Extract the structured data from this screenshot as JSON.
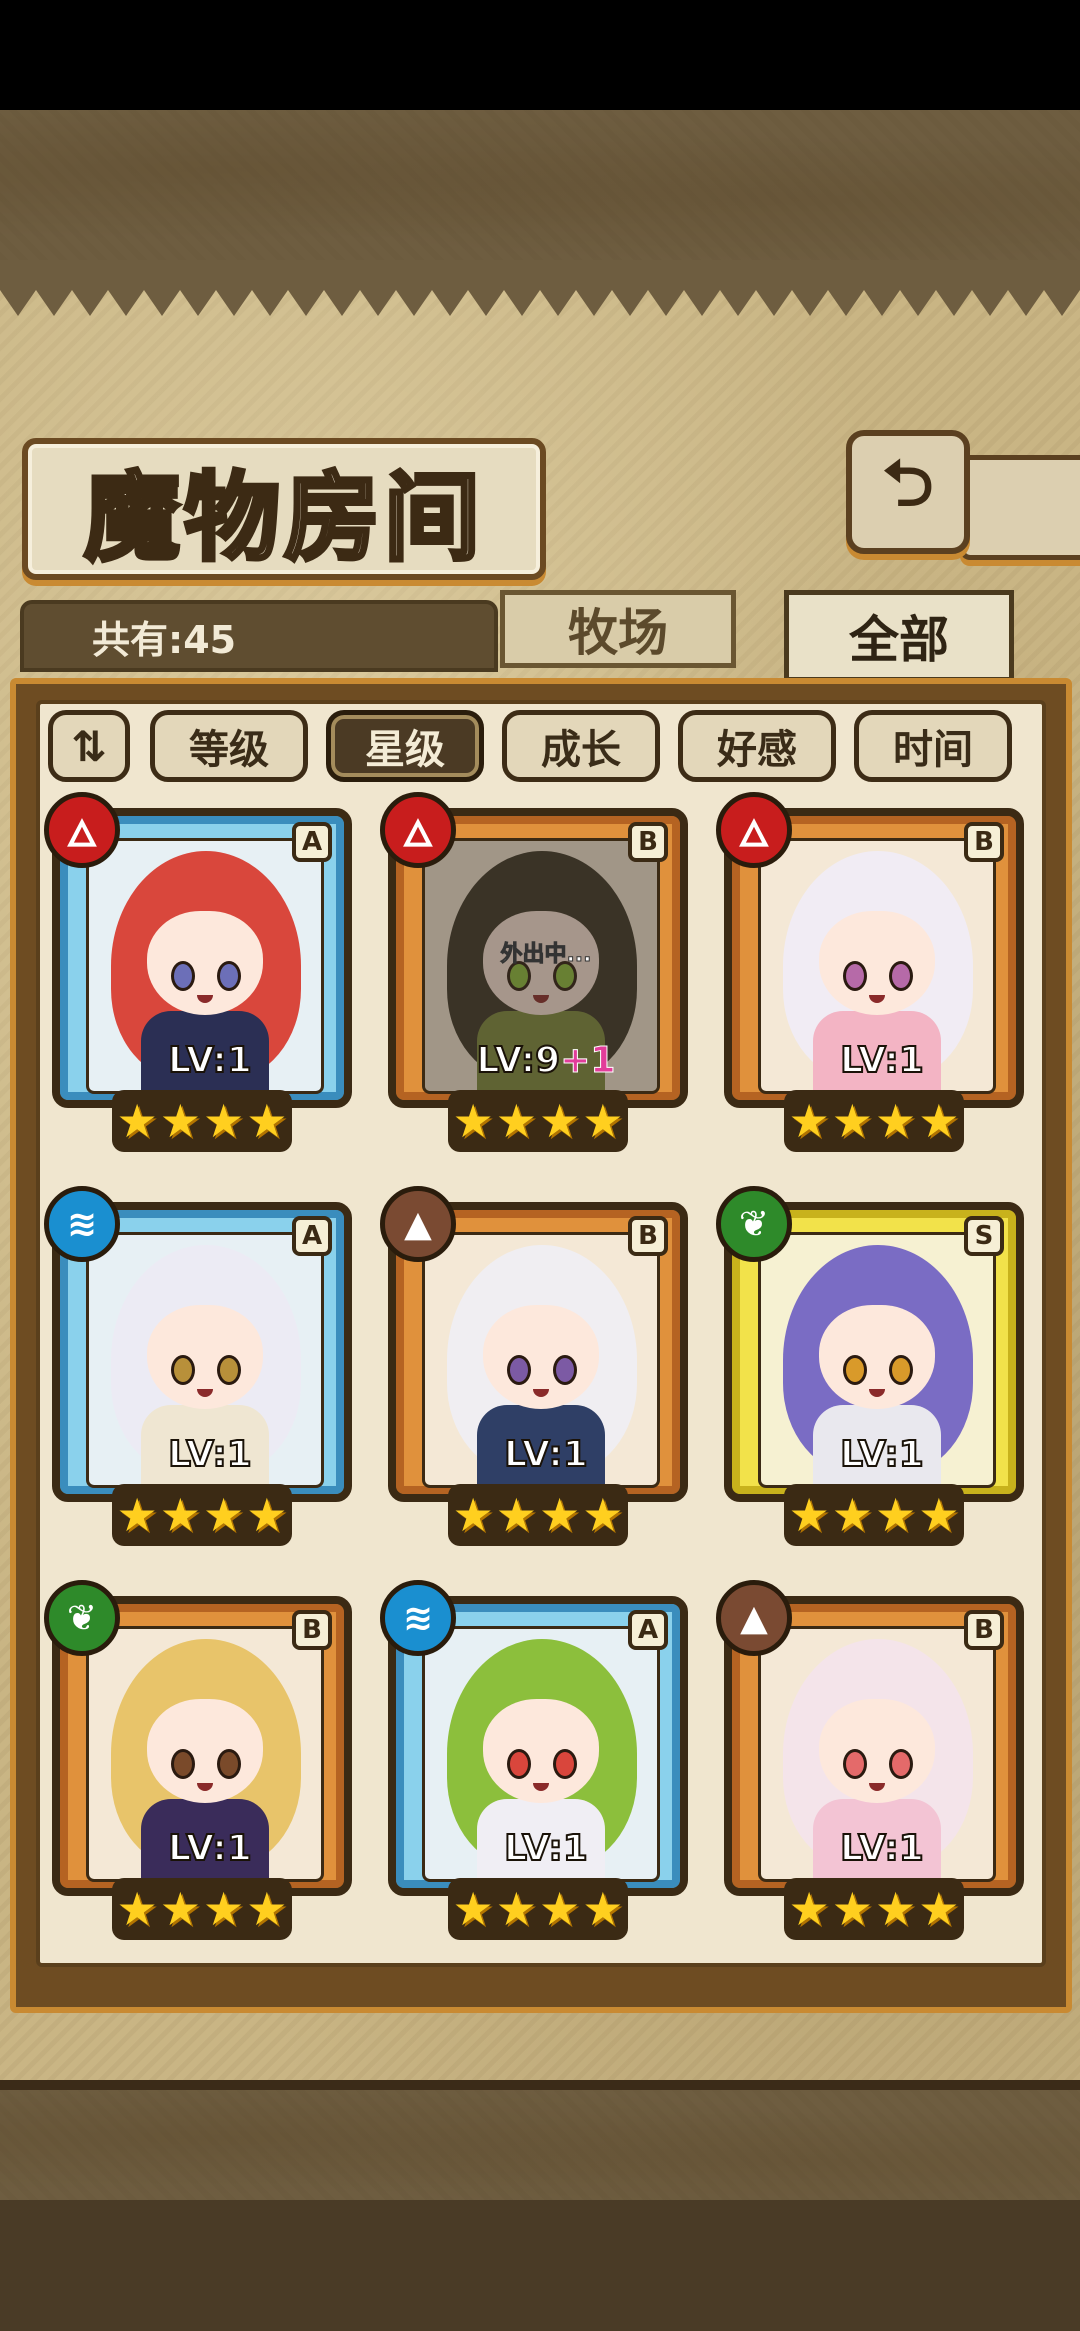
{
  "title": "魔物房间",
  "back_icon": "back-return-icon",
  "count_label": "共有:45",
  "tabs": [
    {
      "label": "牧场",
      "active": false
    },
    {
      "label": "全部",
      "active": true
    }
  ],
  "sort": {
    "toggle_icon": "sort-direction-icon",
    "buttons": [
      {
        "label": "等级",
        "active": false
      },
      {
        "label": "星级",
        "active": true
      },
      {
        "label": "成长",
        "active": false
      },
      {
        "label": "好感",
        "active": false
      },
      {
        "label": "时间",
        "active": false
      }
    ]
  },
  "monsters": [
    {
      "rank": "A",
      "element": "fire",
      "frame": "blue",
      "level": "LV:1",
      "bonus": "",
      "stars": 4,
      "away": "",
      "colors": {
        "hair": "#d9473c",
        "body": "#2b2f54",
        "eye": "#6c6fb8"
      }
    },
    {
      "rank": "B",
      "element": "fire",
      "frame": "orange",
      "level": "LV:9",
      "bonus": "+1",
      "stars": 4,
      "away": "外出中...",
      "colors": {
        "hair": "#3a3326",
        "body": "#7c8a3c",
        "eye": "#8cc03c"
      }
    },
    {
      "rank": "B",
      "element": "fire",
      "frame": "orange",
      "level": "LV:1",
      "bonus": "",
      "stars": 4,
      "away": "",
      "colors": {
        "hair": "#f1ecf4",
        "body": "#f3b4c4",
        "eye": "#b66aa8"
      }
    },
    {
      "rank": "A",
      "element": "water",
      "frame": "blue",
      "level": "LV:1",
      "bonus": "",
      "stars": 4,
      "away": "",
      "colors": {
        "hair": "#ecebf4",
        "body": "#efe6d2",
        "eye": "#b8903a"
      }
    },
    {
      "rank": "B",
      "element": "earth",
      "frame": "orange",
      "level": "LV:1",
      "bonus": "",
      "stars": 4,
      "away": "",
      "colors": {
        "hair": "#f0eef2",
        "body": "#2f3f66",
        "eye": "#7c5aa4"
      }
    },
    {
      "rank": "S",
      "element": "wind",
      "frame": "yellow",
      "level": "LV:1",
      "bonus": "",
      "stars": 4,
      "away": "",
      "colors": {
        "hair": "#7a6cc4",
        "body": "#e9e8ee",
        "eye": "#d99a2a"
      }
    },
    {
      "rank": "B",
      "element": "wind",
      "frame": "orange",
      "level": "LV:1",
      "bonus": "",
      "stars": 4,
      "away": "",
      "colors": {
        "hair": "#e8c46a",
        "body": "#3a2c5a",
        "eye": "#7a4a2a"
      }
    },
    {
      "rank": "A",
      "element": "water",
      "frame": "blue",
      "level": "LV:1",
      "bonus": "",
      "stars": 4,
      "away": "",
      "colors": {
        "hair": "#8cbf3c",
        "body": "#f0eef4",
        "eye": "#d9463c"
      }
    },
    {
      "rank": "B",
      "element": "earth",
      "frame": "orange",
      "level": "LV:1",
      "bonus": "",
      "stars": 4,
      "away": "",
      "colors": {
        "hair": "#f4e4ea",
        "body": "#f3c4d4",
        "eye": "#e46a6a"
      }
    }
  ]
}
